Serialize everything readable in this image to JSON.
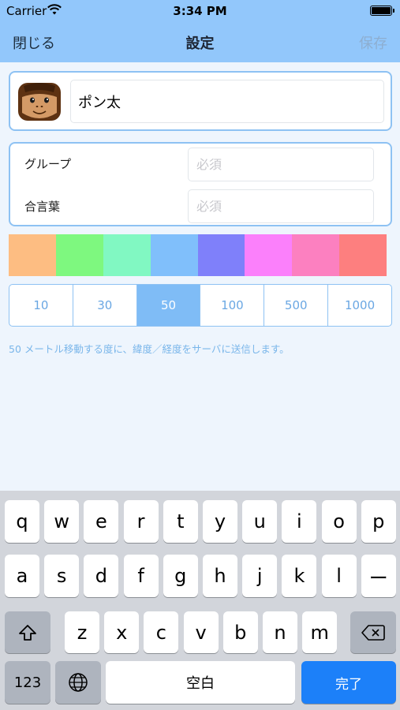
{
  "status": {
    "carrier": "Carrier",
    "time": "3:34 PM"
  },
  "nav": {
    "close": "閉じる",
    "title": "設定",
    "save": "保存"
  },
  "profile": {
    "name": "ポン太",
    "avatar_icon": "monkey-face-icon"
  },
  "fields": {
    "group_label": "グループ",
    "group_placeholder": "必須",
    "password_label": "合言葉",
    "password_placeholder": "必須"
  },
  "colors": [
    "#fdbd82",
    "#7ef87f",
    "#81f8c2",
    "#80bffb",
    "#7f80fa",
    "#fb80fb",
    "#fc80c0",
    "#fd7f7f"
  ],
  "distances": {
    "options": [
      "10",
      "30",
      "50",
      "100",
      "500",
      "1000"
    ],
    "selected": "50"
  },
  "info_text": "50 メートル移動する度に、緯度／経度をサーバに送信します。",
  "keyboard": {
    "row1": [
      "q",
      "w",
      "e",
      "r",
      "t",
      "y",
      "u",
      "i",
      "o",
      "p"
    ],
    "row2": [
      "a",
      "s",
      "d",
      "f",
      "g",
      "h",
      "j",
      "k",
      "l",
      "ー"
    ],
    "row3": [
      "z",
      "x",
      "c",
      "v",
      "b",
      "n",
      "m"
    ],
    "numbers_label": "123",
    "space_label": "空白",
    "done_label": "完了"
  }
}
